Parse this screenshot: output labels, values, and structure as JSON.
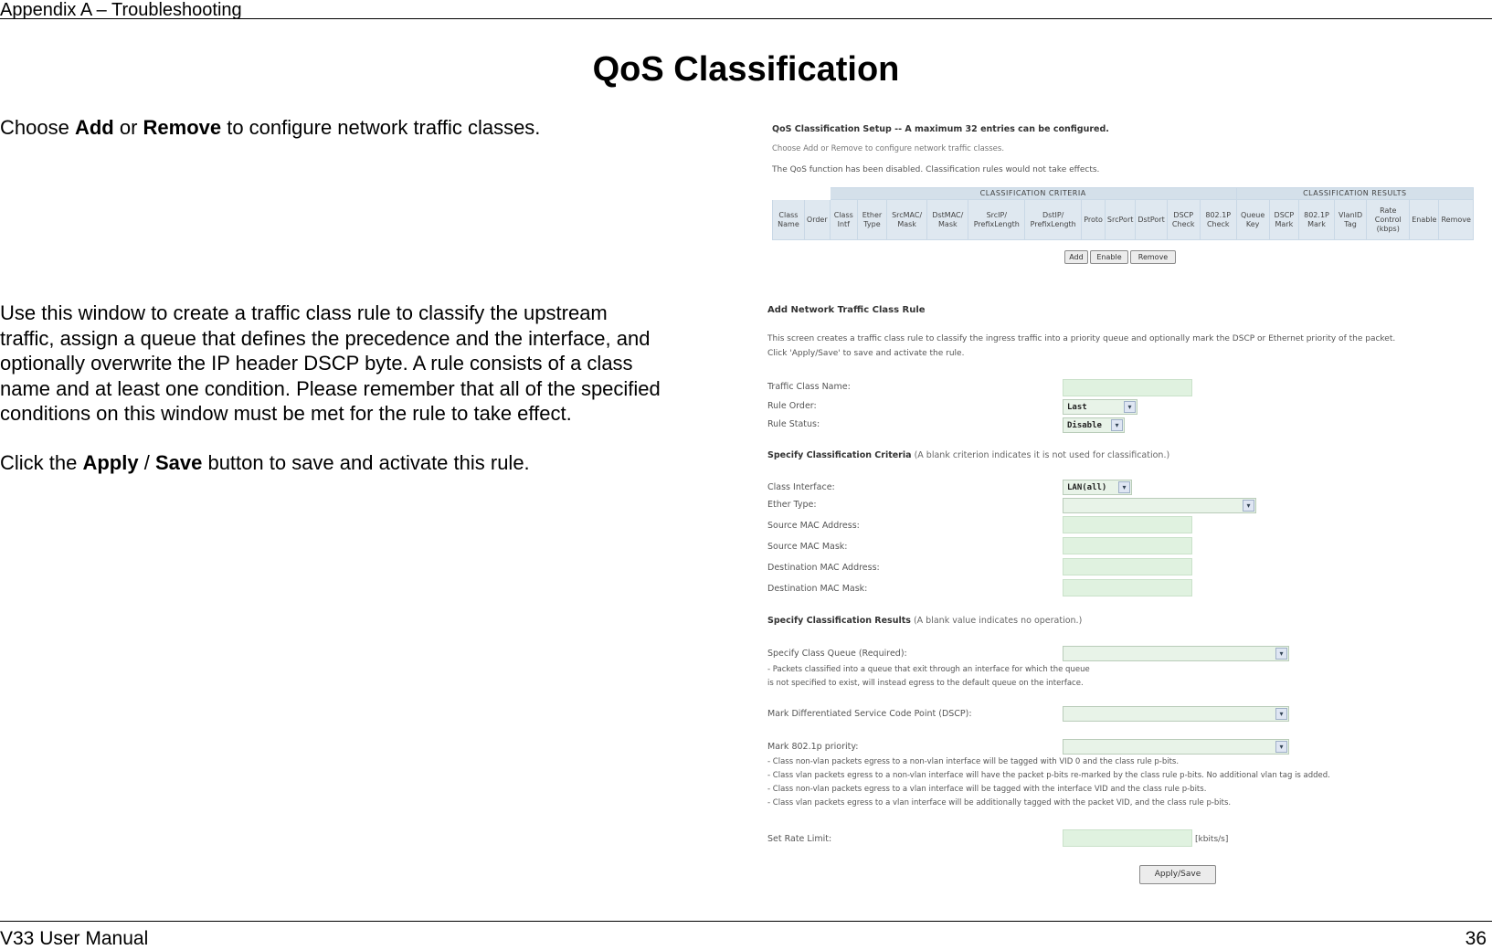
{
  "header": {
    "section": "Appendix A – Troubleshooting"
  },
  "title": "QoS Classification",
  "para1": {
    "prefix": "Choose ",
    "add": "Add",
    "mid": " or ",
    "remove": "Remove",
    "suffix": " to configure network traffic classes."
  },
  "para2": {
    "lines": [
      "Use this window to create a traffic class rule to classify the upstream",
      "traffic, assign a queue that defines the precedence and the interface, and",
      "optionally overwrite the IP header DSCP byte. A rule consists of a class",
      "name and at least one condition. Please remember that all of the specified",
      "conditions on this window must be met for the rule to take effect."
    ]
  },
  "para3": {
    "prefix": "Click the ",
    "apply": "Apply",
    "slash": " / ",
    "save": "Save",
    "suffix": " button to save and activate this rule."
  },
  "footer": {
    "manual": "V33 User Manual",
    "page": "36"
  },
  "shot1": {
    "heading": "QoS Classification Setup -- A maximum 32 entries can be configured.",
    "line1": "Choose Add or Remove to configure network traffic classes.",
    "line2": "The QoS function has been disabled. Classification rules would not take effects.",
    "group_criteria": "CLASSIFICATION CRITERIA",
    "group_results": "CLASSIFICATION RESULTS",
    "columns": [
      "Class Name",
      "Order",
      "Class Intf",
      "Ether Type",
      "SrcMAC/ Mask",
      "DstMAC/ Mask",
      "SrcIP/ PrefixLength",
      "DstIP/ PrefixLength",
      "Proto",
      "SrcPort",
      "DstPort",
      "DSCP Check",
      "802.1P Check",
      "Queue Key",
      "DSCP Mark",
      "802.1P Mark",
      "VlanID Tag",
      "Rate Control (kbps)",
      "Enable",
      "Remove"
    ],
    "buttons": {
      "add": "Add",
      "enable": "Enable",
      "remove": "Remove"
    }
  },
  "shot2": {
    "heading": "Add Network Traffic Class Rule",
    "intro1": "This screen creates a traffic class rule to classify the ingress traffic into a priority queue and optionally mark the DSCP or Ethernet priority of the packet.",
    "intro2": "Click 'Apply/Save' to save and activate the rule.",
    "class_name_label": "Traffic Class Name:",
    "rule_order_label": "Rule Order:",
    "rule_order_value": "Last",
    "rule_status_label": "Rule Status:",
    "rule_status_value": "Disable",
    "criteria_heading": "Specify Classification Criteria",
    "criteria_note": "(A blank criterion indicates it is not used for classification.)",
    "class_intf_label": "Class Interface:",
    "class_intf_value": "LAN(all)",
    "ether_type_label": "Ether Type:",
    "src_mac_label": "Source MAC Address:",
    "src_mac_mask_label": "Source MAC Mask:",
    "dst_mac_label": "Destination MAC Address:",
    "dst_mac_mask_label": "Destination MAC Mask:",
    "results_heading": "Specify Classification Results",
    "results_note": "(A blank value indicates no operation.)",
    "queue_label": "Specify Class Queue (Required):",
    "queue_note1": "- Packets classified into a queue that exit through an interface for which the queue",
    "queue_note2": "is not specified to exist, will instead egress to the default queue on the interface.",
    "dscp_label": "Mark Differentiated Service Code Point (DSCP):",
    "p8021_label": "Mark 802.1p priority:",
    "p_note1": "- Class non-vlan packets egress to a non-vlan interface will be tagged with VID 0 and the class rule p-bits.",
    "p_note2": "- Class vlan packets egress to a non-vlan interface will have the packet p-bits re-marked by the class rule p-bits. No additional vlan tag is added.",
    "p_note3": "- Class non-vlan packets egress to a vlan interface will be tagged with the interface VID and the class rule p-bits.",
    "p_note4": "- Class vlan packets egress to a vlan interface will be additionally tagged with the packet VID, and the class rule p-bits.",
    "rate_label": "Set Rate Limit:",
    "rate_unit": "[kbits/s]",
    "apply_button": "Apply/Save"
  }
}
